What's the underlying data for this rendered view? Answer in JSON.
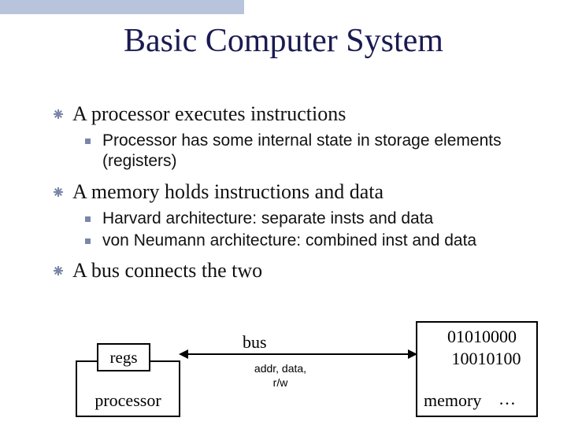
{
  "title": "Basic Computer System",
  "bullets": [
    {
      "text": "A processor executes instructions",
      "sub": [
        "Processor has some internal state in storage elements (registers)"
      ]
    },
    {
      "text": "A memory holds instructions and data",
      "sub": [
        "Harvard architecture: separate insts and data",
        "von Neumann architecture: combined inst and data"
      ]
    },
    {
      "text": "A bus connects the two",
      "sub": []
    }
  ],
  "diagram": {
    "processor": "processor",
    "regs": "regs",
    "memory": "memory",
    "bus": "bus",
    "bus_sub": "addr, data,\nr/w",
    "mem_lines": [
      "01010000",
      " 10010100"
    ],
    "mem_dots": "…"
  }
}
